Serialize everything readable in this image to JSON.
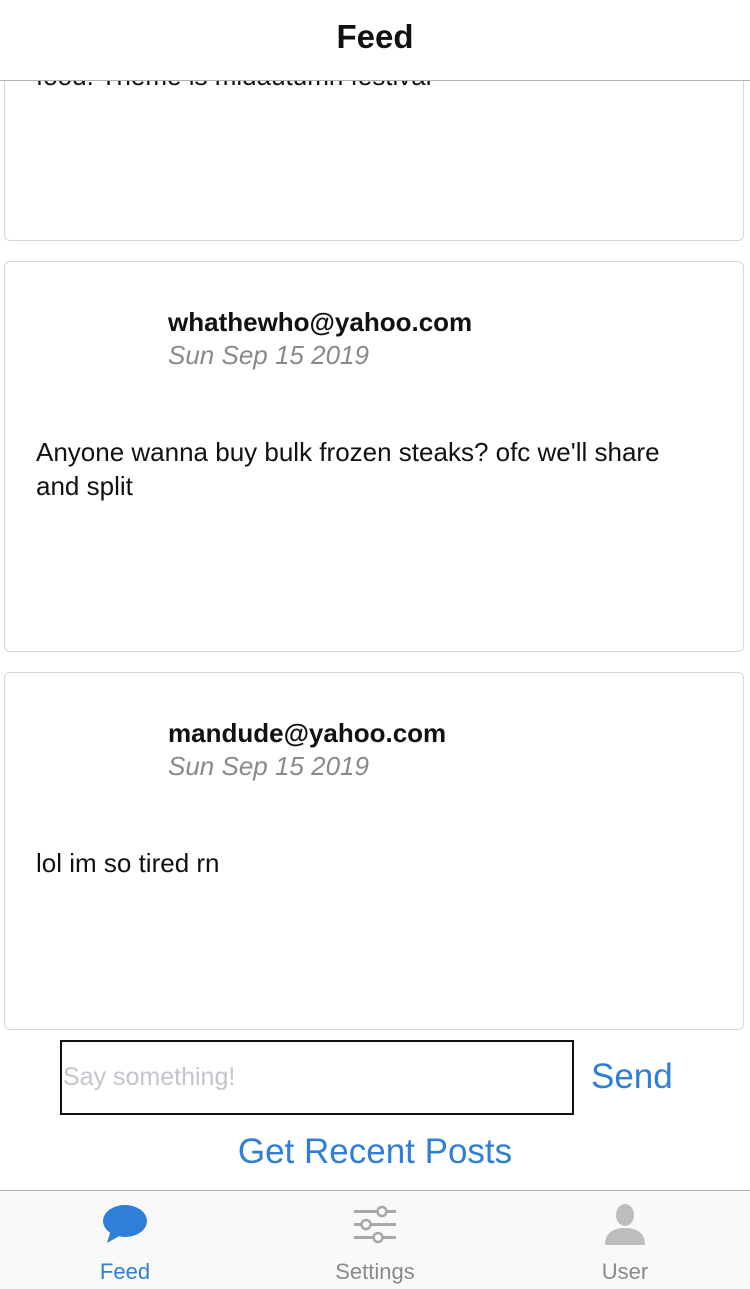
{
  "app": {
    "title": "Feed"
  },
  "posts": [
    {
      "author": "",
      "date": "",
      "body": "food. Theme is midautumn festival"
    },
    {
      "author": "whathewho@yahoo.com",
      "date": "Sun Sep 15 2019",
      "body": "Anyone wanna buy bulk frozen steaks? ofc we'll share and split"
    },
    {
      "author": "mandude@yahoo.com",
      "date": "Sun Sep 15 2019",
      "body": "lol im so tired rn"
    }
  ],
  "composer": {
    "placeholder": "Say something!",
    "value": "",
    "send_label": "Send"
  },
  "actions": {
    "recent_label": "Get Recent Posts"
  },
  "tabs": [
    {
      "label": "Feed",
      "icon": "chat-bubble-icon",
      "active": true
    },
    {
      "label": "Settings",
      "icon": "sliders-icon",
      "active": false
    },
    {
      "label": "User",
      "icon": "user-icon",
      "active": false
    }
  ],
  "colors": {
    "accent": "#2f7fd8",
    "inactive": "#a8a8a8",
    "card_border": "#d7d7d7"
  }
}
